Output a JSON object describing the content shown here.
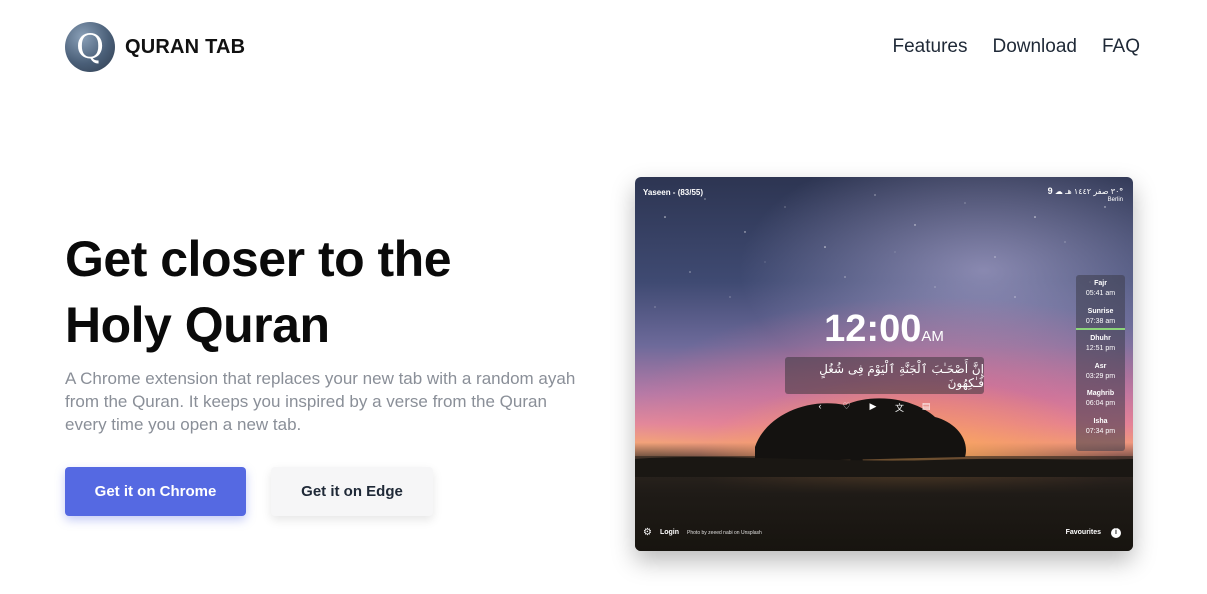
{
  "header": {
    "logo_letter": "Q",
    "brand": "QURAN TAB",
    "nav": [
      "Features",
      "Download",
      "FAQ"
    ]
  },
  "hero": {
    "headline_line1": "Get closer to the",
    "headline_line2": "Holy Quran",
    "subtitle": "A Chrome extension that replaces your new tab with a random ayah from the Quran. It keeps you inspired by a verse from the Quran every time you open a new tab.",
    "button_chrome": "Get it on Chrome",
    "button_edge": "Get it on Edge"
  },
  "colors": {
    "accent": "#5569e2",
    "secondary_button": "#f6f6f7"
  },
  "preview": {
    "surah_label": "Yaseen - (83/55)",
    "hijri_date": "٣٠ صفر ١٤٤٢ هـ",
    "temperature": "9°",
    "city": "Berlin",
    "weather_icon": "cloud-sun-icon",
    "time": "12:00",
    "ampm": "AM",
    "verse_text": "إِنَّ أَصْحَـٰبَ ٱلْجَنَّةِ ٱلْيَوْمَ فِى شُغُلٍ فَـٰكِهُونَ",
    "controls": [
      "chevron-left-icon",
      "heart-icon",
      "play-icon",
      "translate-icon",
      "book-icon"
    ],
    "prayers": [
      {
        "name": "Fajr",
        "time": "05:41 am"
      },
      {
        "name": "Sunrise",
        "time": "07:38 am"
      },
      {
        "name": "Dhuhr",
        "time": "12:51 pm"
      },
      {
        "name": "Asr",
        "time": "03:29 pm"
      },
      {
        "name": "Maghrib",
        "time": "06:04 pm"
      },
      {
        "name": "Isha",
        "time": "07:34 pm"
      }
    ],
    "footer": {
      "login": "Login",
      "credit": "Photo by zeeed nabi on Unsplash",
      "favourites": "Favourites",
      "info": "i"
    }
  }
}
